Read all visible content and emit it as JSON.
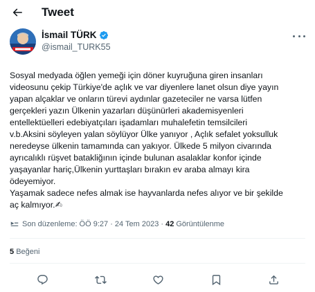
{
  "header": {
    "title": "Tweet"
  },
  "author": {
    "display_name": "İsmail TÜRK",
    "handle": "@ismail_TURK55"
  },
  "tweet": {
    "text": "Sosyal medyada öğlen yemeği için döner kuyruğuna giren insanları\nvideosunu çekip Türkiye'de açlık ve var diyenlere lanet olsun diye yayın\nyapan alçaklar ve onların türevi aydınlar gazeteciler ne varsa lütfen\ngerçekleri yazın Ülkenin yazarları düşünürleri akademisyenleri\nentellektüelleri edebiyatçıları işadamları muhalefetin temsilcileri\nv.b.Aksini söyleyen yalan söylüyor Ülke yanıyor , Açlık sefalet yoksulluk\nneredeyse ülkenin tamamında can yakıyor. Ülkede 5 milyon civarında\nayrıcalıklı rüşvet batakliğının içinde bulunan asalaklar konfor içinde\nyaşayanlar hariç,Ülkenin yurttaşları bırakın ev araba almayı kira\nödeyemiyor.\nYaşamak sadece nefes almak ise hayvanlarda nefes alıyor ve bir şekilde\naç kalmıyor.✍"
  },
  "meta": {
    "edited": "Son düzenleme: ÖÖ 9:27 · 24 Tem 2023 ·",
    "views_count": "42",
    "views_label": "Görüntülenme"
  },
  "likes": {
    "count": "5",
    "label": "Beğeni"
  },
  "icons": {
    "back": "arrow-left-icon",
    "verified": "verified-badge-icon",
    "more": "more-icon",
    "stats": "stats-icon",
    "reply": "reply-icon",
    "retweet": "retweet-icon",
    "like": "heart-icon",
    "bookmark": "bookmark-icon",
    "share": "share-icon"
  },
  "colors": {
    "text": "#0f1419",
    "secondary": "#536471",
    "verified": "#1d9bf0",
    "divider": "#eff3f4"
  }
}
